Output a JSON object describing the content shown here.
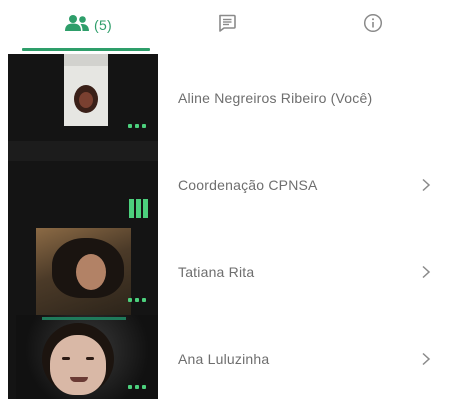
{
  "tabs": {
    "people": {
      "icon": "people-icon",
      "count_label": "(5)"
    },
    "chat": {
      "icon": "chat-icon"
    },
    "info": {
      "icon": "info-icon"
    },
    "active": "people"
  },
  "participants": [
    {
      "name": "Aline Negreiros Ribeiro (Você)",
      "indicator": "more-dots",
      "has_chevron": false
    },
    {
      "name": "Coordenação CPNSA",
      "indicator": "audio-level-bars",
      "has_chevron": true
    },
    {
      "name": "Tatiana Rita",
      "indicator": "more-dots",
      "has_chevron": true
    },
    {
      "name": "Ana Luluzinha",
      "indicator": "more-dots",
      "has_chevron": true
    }
  ],
  "colors": {
    "accent": "#2e9e6a",
    "indicator_green": "#4cd07d",
    "name_text": "#6e6e6e",
    "icon_gray": "#8a8a8a",
    "tile_dark": "#141414"
  }
}
